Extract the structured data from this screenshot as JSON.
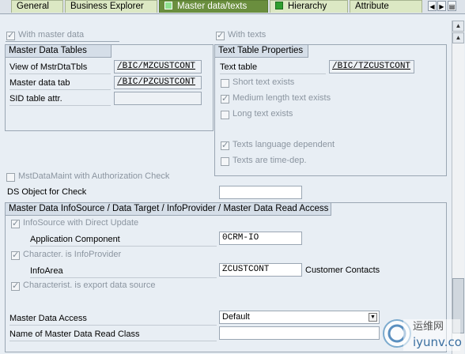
{
  "tabs": [
    {
      "label": "General",
      "active": false,
      "indicator": false
    },
    {
      "label": "Business Explorer",
      "active": false,
      "indicator": false
    },
    {
      "label": "Master data/texts",
      "active": true,
      "indicator": true
    },
    {
      "label": "Hierarchy",
      "active": false,
      "indicator": true
    },
    {
      "label": "Attribute",
      "active": false,
      "indicator": false
    }
  ],
  "top_checks": {
    "with_master_data": "With master data",
    "with_texts": "With texts"
  },
  "master_data_tables": {
    "title": "Master Data Tables",
    "rows": [
      {
        "label": "View of MstrDtaTbls",
        "value": "/BIC/MZCUSTCONT"
      },
      {
        "label": "Master data tab",
        "value": "/BIC/PZCUSTCONT"
      },
      {
        "label": "SID table attr.",
        "value": ""
      }
    ]
  },
  "text_table": {
    "title": "Text Table Properties",
    "label": "Text table",
    "value": "/BIC/TZCUSTCONT",
    "checks": [
      {
        "label": "Short text exists",
        "checked": false
      },
      {
        "label": "Medium length text exists",
        "checked": true
      },
      {
        "label": "Long text exists",
        "checked": false
      },
      {
        "label": "Texts language dependent",
        "checked": true
      },
      {
        "label": "Texts are time-dep.",
        "checked": false
      }
    ]
  },
  "auth_check": {
    "label": "MstDataMaint with Authorization Check",
    "checked": false
  },
  "ds_object": {
    "label": "DS Object for Check",
    "value": ""
  },
  "infosource": {
    "title": "Master Data InfoSource / Data Target / InfoProvider / Master Data Read Access",
    "direct_update": "InfoSource with Direct Update",
    "app_component_label": "Application Component",
    "app_component_value": "0CRM-IO",
    "is_infoprovider": "Character. is InfoProvider",
    "infoarea_label": "InfoArea",
    "infoarea_value": "ZCUSTCONT",
    "infoarea_text": "Customer Contacts",
    "export_ds": "Characterist. is export data source",
    "md_access_label": "Master Data Access",
    "md_access_value": "Default",
    "read_class_label": "Name of Master Data Read Class",
    "read_class_value": ""
  },
  "watermark": {
    "line1": "运维网",
    "line2": "iyunv.com"
  }
}
